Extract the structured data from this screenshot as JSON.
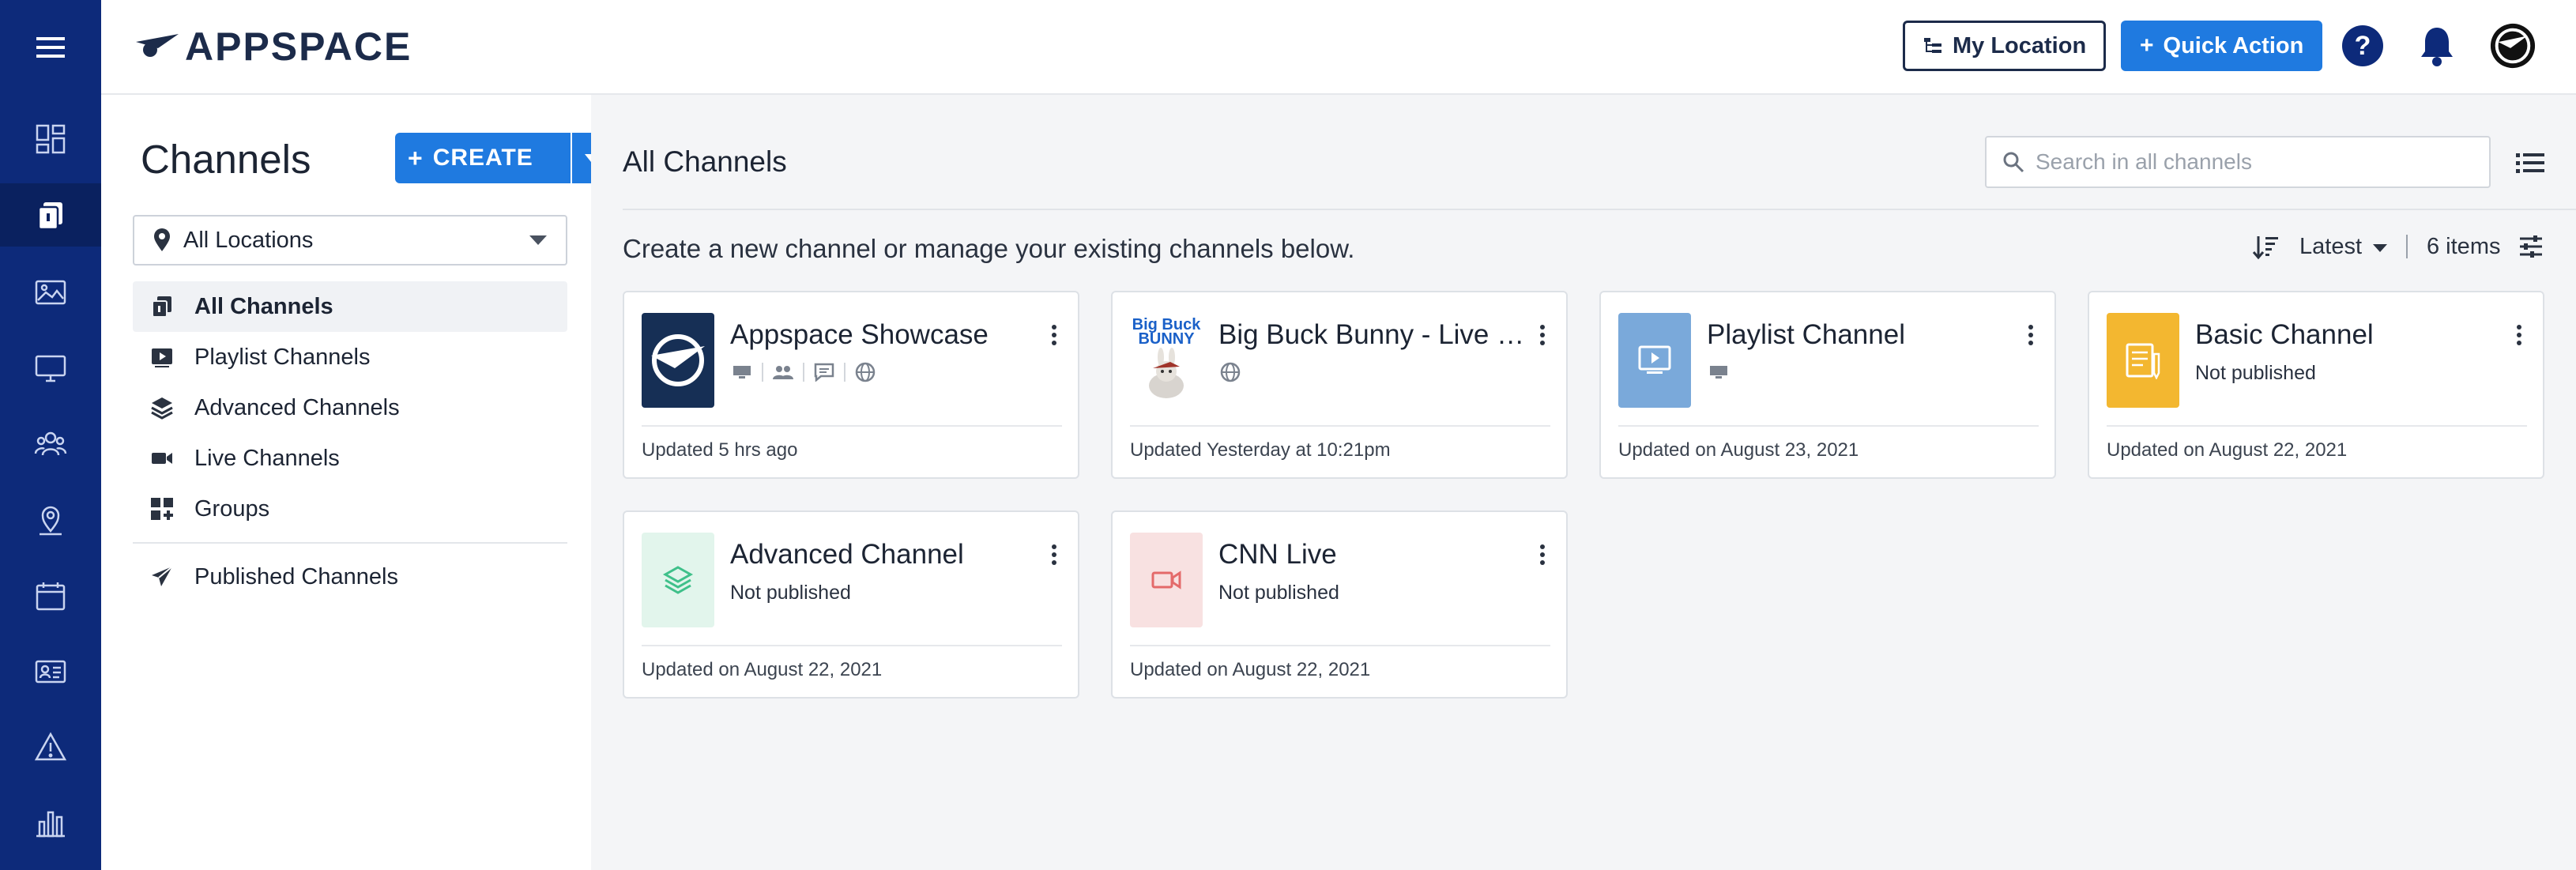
{
  "app": {
    "logo_text": "APPSPACE"
  },
  "rail": {
    "items": [
      {
        "icon": "menu-icon"
      },
      {
        "icon": "dashboard-icon"
      },
      {
        "icon": "channels-icon",
        "active": true
      },
      {
        "icon": "image-icon"
      },
      {
        "icon": "monitor-icon"
      },
      {
        "icon": "users-icon"
      },
      {
        "icon": "location-icon"
      },
      {
        "icon": "calendar-icon"
      },
      {
        "icon": "id-card-icon"
      },
      {
        "icon": "warning-icon"
      },
      {
        "icon": "bar-chart-icon"
      }
    ]
  },
  "topbar": {
    "my_location": "My Location",
    "quick_action": "Quick Action"
  },
  "sidebar": {
    "title": "Channels",
    "create_label": "CREATE",
    "location_filter": "All Locations",
    "nav": [
      {
        "label": "All Channels",
        "icon": "channels-icon",
        "active": true
      },
      {
        "label": "Playlist Channels",
        "icon": "playlist-icon"
      },
      {
        "label": "Advanced Channels",
        "icon": "layers-icon"
      },
      {
        "label": "Live Channels",
        "icon": "video-camera-icon"
      },
      {
        "label": "Groups",
        "icon": "groups-icon"
      },
      {
        "label": "Published Channels",
        "icon": "paper-plane-icon"
      }
    ]
  },
  "main": {
    "title": "All Channels",
    "search_placeholder": "Search in all channels",
    "subtitle": "Create a new channel or manage your existing channels below.",
    "sort_label": "Latest",
    "item_count": "6 items",
    "cards": [
      {
        "title": "Appspace Showcase",
        "updated": "Updated 5 hrs ago",
        "sub": ""
      },
      {
        "title": "Big Buck Bunny - Live St...",
        "updated": "Updated Yesterday at 10:21pm",
        "sub": "",
        "thumb_text": "Big Buck BUNNY"
      },
      {
        "title": "Playlist Channel",
        "updated": "Updated on August 23, 2021",
        "sub": ""
      },
      {
        "title": "Basic Channel",
        "updated": "Updated on August 22, 2021",
        "sub": "Not published"
      },
      {
        "title": "Advanced Channel",
        "updated": "Updated on August 22, 2021",
        "sub": "Not published"
      },
      {
        "title": "CNN Live",
        "updated": "Updated on August 22, 2021",
        "sub": "Not published"
      }
    ]
  },
  "colors": {
    "rail": "#0d2a7a",
    "primary": "#1f7ae0",
    "basic_thumb": "#f3b730",
    "playlist_thumb": "#7aa9da",
    "advanced_thumb": "#e2f5ec",
    "live_thumb": "#f8e1e1"
  }
}
